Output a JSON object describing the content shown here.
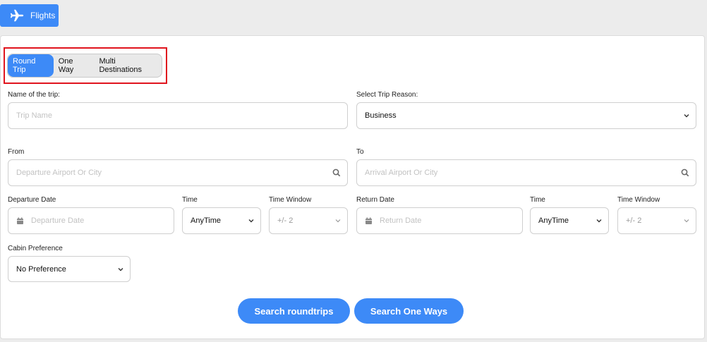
{
  "header": {
    "flights_label": "Flights"
  },
  "trip_type": {
    "options": [
      "Round Trip",
      "One Way",
      "Multi Destinations"
    ],
    "selected": "Round Trip"
  },
  "trip_name": {
    "label": "Name of the trip:",
    "placeholder": "Trip Name"
  },
  "trip_reason": {
    "label": "Select Trip Reason:",
    "value": "Business"
  },
  "from": {
    "label": "From",
    "placeholder": "Departure Airport Or City"
  },
  "to": {
    "label": "To",
    "placeholder": "Arrival Airport Or City"
  },
  "departure": {
    "date_label": "Departure Date",
    "date_placeholder": "Departure Date",
    "time_label": "Time",
    "time_value": "AnyTime",
    "window_label": "Time Window",
    "window_value": "+/- 2"
  },
  "return": {
    "date_label": "Return Date",
    "date_placeholder": "Return Date",
    "time_label": "Time",
    "time_value": "AnyTime",
    "window_label": "Time Window",
    "window_value": "+/- 2"
  },
  "cabin": {
    "label": "Cabin Preference",
    "value": "No Preference"
  },
  "actions": {
    "search_roundtrips": "Search roundtrips",
    "search_one_ways": "Search One Ways"
  },
  "colors": {
    "accent": "#3d8af7",
    "highlight_border": "#e0141e"
  },
  "icons": [
    "airplane-icon",
    "search-icon",
    "calendar-icon",
    "chevron-down-icon"
  ]
}
